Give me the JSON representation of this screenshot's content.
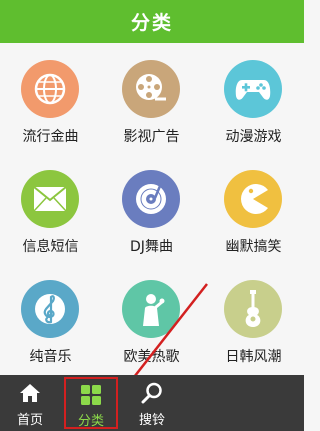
{
  "header": {
    "title": "分类"
  },
  "categories": [
    {
      "label": "流行金曲",
      "icon": "globe-icon",
      "color": "#f29a6c"
    },
    {
      "label": "影视广告",
      "icon": "film-reel-icon",
      "color": "#c9a67a"
    },
    {
      "label": "动漫游戏",
      "icon": "gamepad-icon",
      "color": "#5cc6d8"
    },
    {
      "label": "信息短信",
      "icon": "envelope-icon",
      "color": "#8cc63f"
    },
    {
      "label": "DJ舞曲",
      "icon": "vinyl-record-icon",
      "color": "#6a7dbf"
    },
    {
      "label": "幽默搞笑",
      "icon": "pacman-icon",
      "color": "#f0c040"
    },
    {
      "label": "纯音乐",
      "icon": "treble-clef-icon",
      "color": "#5aa8c8"
    },
    {
      "label": "欧美热歌",
      "icon": "singer-icon",
      "color": "#5fc6a6"
    },
    {
      "label": "日韩风潮",
      "icon": "guitar-icon",
      "color": "#c8cf8c"
    }
  ],
  "tabs": [
    {
      "label": "首页",
      "icon": "home-icon"
    },
    {
      "label": "分类",
      "icon": "grid-icon"
    },
    {
      "label": "搜铃",
      "icon": "search-icon"
    }
  ]
}
